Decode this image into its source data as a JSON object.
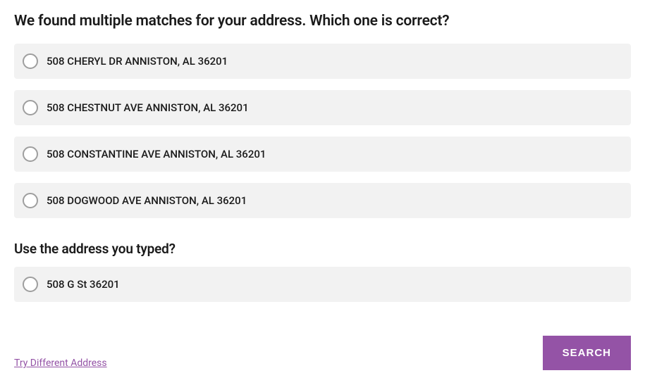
{
  "heading": "We found multiple matches for your address. Which one is correct?",
  "options": [
    "508 CHERYL DR ANNISTON, AL 36201",
    "508 CHESTNUT AVE ANNISTON, AL 36201",
    "508 CONSTANTINE AVE ANNISTON, AL 36201",
    "508 DOGWOOD AVE ANNISTON, AL 36201"
  ],
  "typed_heading": "Use the address you typed?",
  "typed_option": "508 G St 36201",
  "footer": {
    "link_label": "Try Different Address",
    "search_label": "SEARCH"
  }
}
